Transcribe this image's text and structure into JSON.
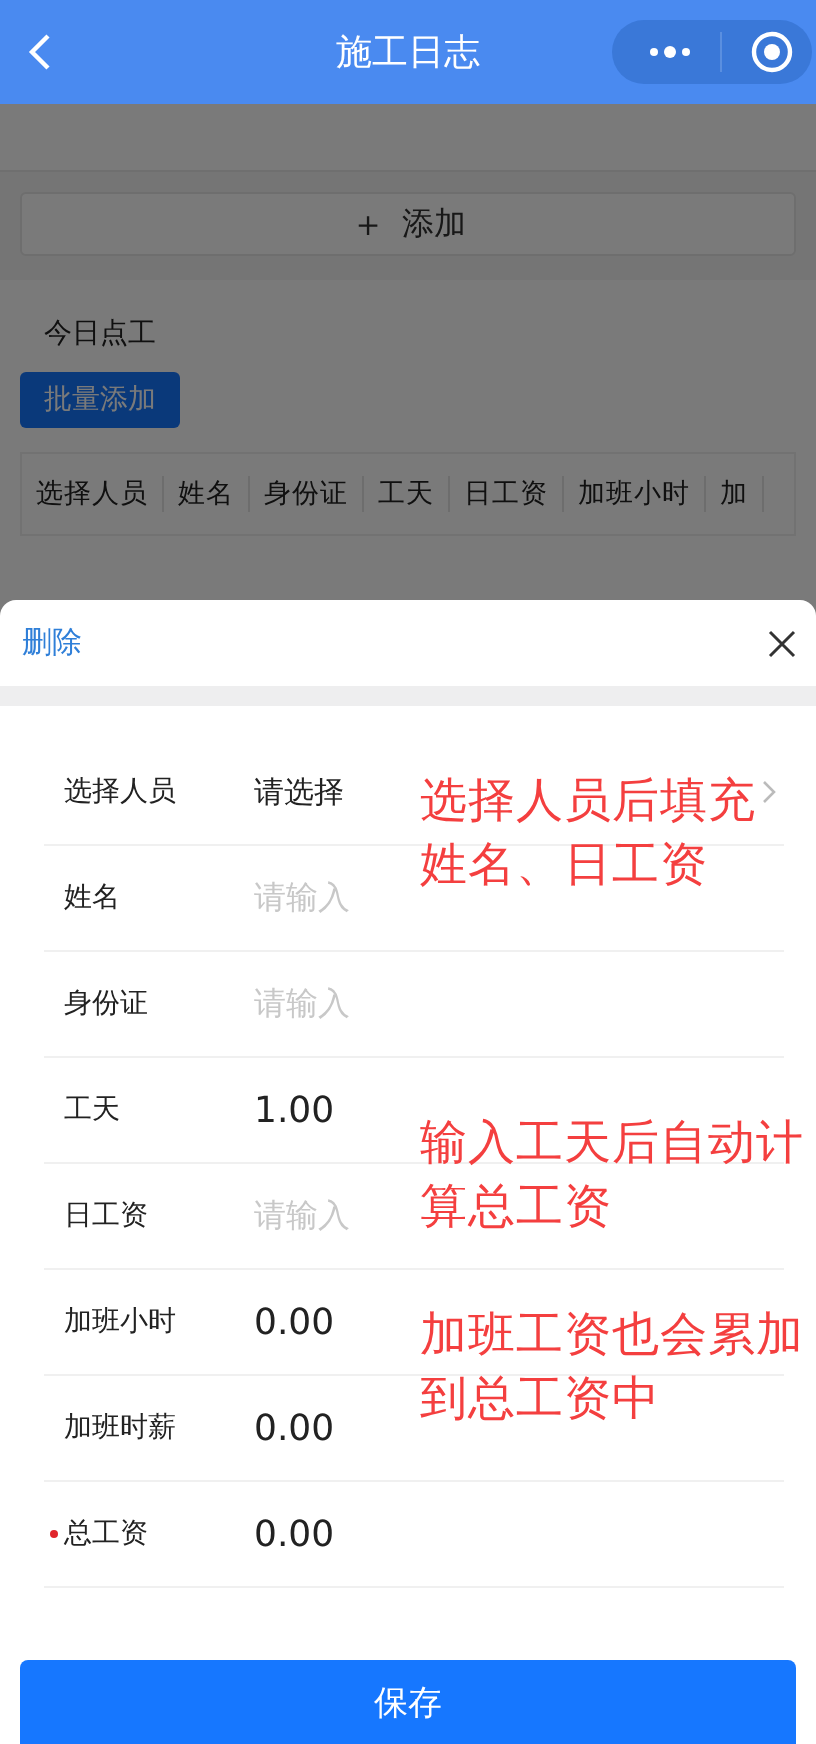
{
  "nav_bar": {
    "title": "施工日志"
  },
  "background_page": {
    "add_button": {
      "icon": "＋",
      "label": "添加"
    },
    "section_title": "今日点工",
    "batch_add_button": "批量添加",
    "table": {
      "columns": [
        "选择人员",
        "姓名",
        "身份证",
        "工天",
        "日工资",
        "加班小时",
        "加"
      ]
    }
  },
  "sheet": {
    "delete_link": "删除",
    "fields": [
      {
        "kind": "select",
        "label": "选择人员",
        "value": "请选择",
        "required": false
      },
      {
        "kind": "input",
        "label": "姓名",
        "placeholder": "请输入",
        "required": false
      },
      {
        "kind": "input",
        "label": "身份证",
        "placeholder": "请输入",
        "required": false
      },
      {
        "kind": "input",
        "label": "工天",
        "value": "1.00",
        "required": false
      },
      {
        "kind": "input",
        "label": "日工资",
        "placeholder": "请输入",
        "required": false
      },
      {
        "kind": "input",
        "label": "加班小时",
        "value": "0.00",
        "required": false
      },
      {
        "kind": "input",
        "label": "加班时薪",
        "value": "0.00",
        "required": false
      },
      {
        "kind": "input",
        "label": "总工资",
        "value": "0.00",
        "required": true
      }
    ],
    "save_button": "保存"
  },
  "annotations": [
    {
      "lines": [
        "选择人员后填充",
        "姓名、日工资"
      ]
    },
    {
      "lines": [
        "输入工天后自动计",
        "算总工资"
      ]
    },
    {
      "lines": [
        "加班工资也会累加",
        "到总工资中"
      ]
    }
  ]
}
